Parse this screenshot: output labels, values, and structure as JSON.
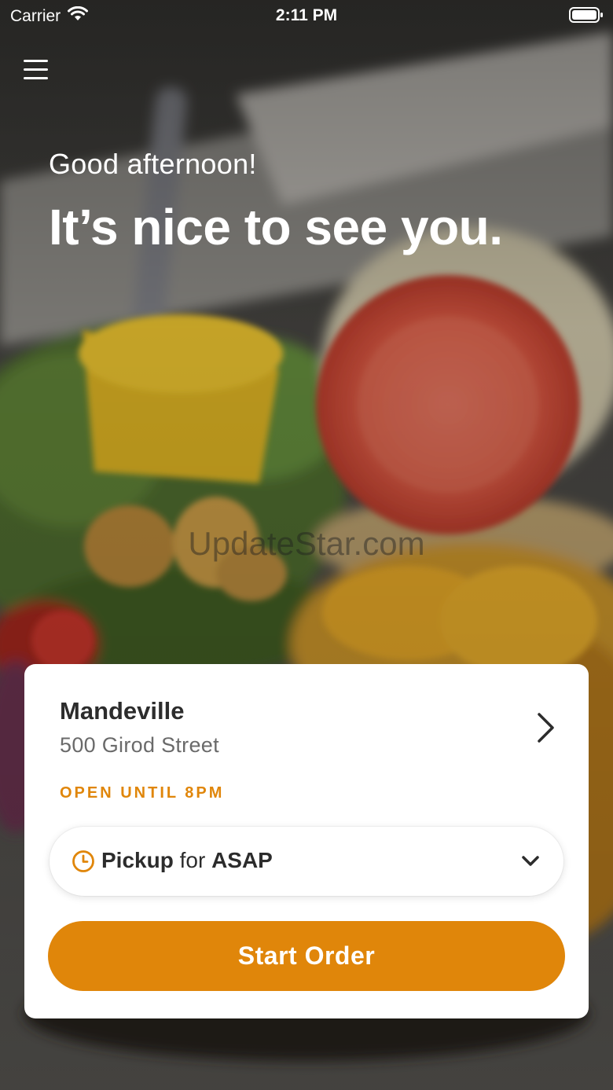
{
  "status_bar": {
    "carrier": "Carrier",
    "time": "2:11 PM",
    "wifi_icon": "wifi-icon",
    "battery_icon": "battery-icon"
  },
  "nav": {
    "menu_icon": "hamburger-menu-icon"
  },
  "hero": {
    "greeting": "Good afternoon!",
    "headline": "It’s nice to see you.",
    "watermark": "UpdateStar.com"
  },
  "store_card": {
    "name": "Mandeville",
    "address": "500 Girod Street",
    "arrow_icon": "chevron-right-icon",
    "open_status": "OPEN UNTIL 8PM",
    "pickup": {
      "clock_icon": "clock-icon",
      "mode": "Pickup",
      "connector": "for",
      "time": "ASAP",
      "chevron_icon": "chevron-down-icon"
    },
    "start_label": "Start Order"
  },
  "colors": {
    "accent": "#E0860A",
    "card_background": "#FFFFFF",
    "text_primary": "#2C2C2C",
    "text_secondary": "#6A6A6A"
  }
}
